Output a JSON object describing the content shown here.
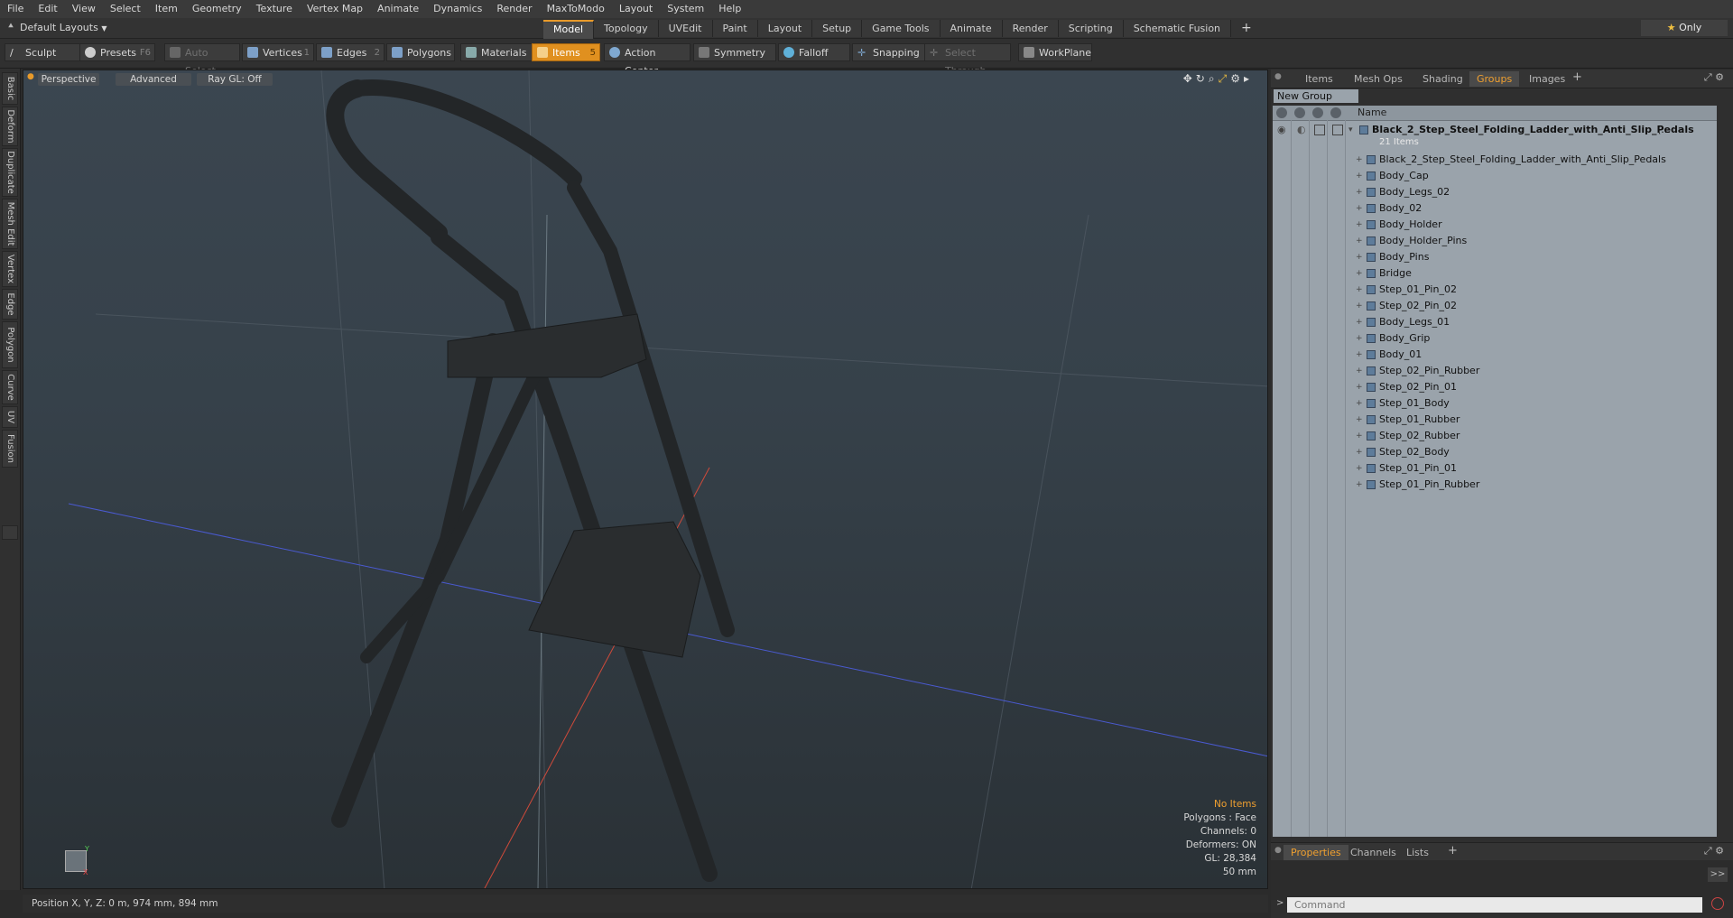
{
  "menu": [
    "File",
    "Edit",
    "View",
    "Select",
    "Item",
    "Geometry",
    "Texture",
    "Vertex Map",
    "Animate",
    "Dynamics",
    "Render",
    "MaxToModo",
    "Layout",
    "System",
    "Help"
  ],
  "layout_select": "Default Layouts",
  "layout_tabs": [
    "Model",
    "Topology",
    "UVEdit",
    "Paint",
    "Layout",
    "Setup",
    "Game Tools",
    "Animate",
    "Render",
    "Scripting",
    "Schematic Fusion"
  ],
  "layout_active": "Model",
  "add_tab": "+",
  "only_label": "Only",
  "toolbar": {
    "sculpt": "Sculpt",
    "presets": "Presets",
    "presets_key": "F6",
    "auto_select": "Auto Select",
    "vertices": "Vertices",
    "vertices_key": "1",
    "edges": "Edges",
    "edges_key": "2",
    "polygons": "Polygons",
    "materials": "Materials",
    "items": "Items",
    "items_key": "5",
    "action_center": "Action Center",
    "symmetry": "Symmetry",
    "falloff": "Falloff",
    "snapping": "Snapping",
    "select_through": "Select Through",
    "workplane": "WorkPlane"
  },
  "left_tabs": [
    "Basic",
    "Deform",
    "Duplicate",
    "Mesh Edit",
    "Vertex",
    "Edge",
    "Polygon",
    "Curve",
    "UV",
    "Fusion"
  ],
  "viewport": {
    "perspective": "Perspective",
    "advanced": "Advanced",
    "raygl": "Ray GL: Off",
    "info": {
      "no_items": "No Items",
      "polygons": "Polygons : Face",
      "channels": "Channels: 0",
      "deformers": "Deformers: ON",
      "gl": "GL: 28,384",
      "scale": "50 mm"
    }
  },
  "status": "Position X, Y, Z:  0 m, 974 mm, 894 mm",
  "right_panel": {
    "tabs": [
      "Items",
      "Mesh Ops",
      "Shading",
      "Groups",
      "Images"
    ],
    "active_tab": "Groups",
    "new_group": "New Group",
    "name_header": "Name",
    "group_name": "Black_2_Step_Steel_Folding_Ladder_with_Anti_Slip_Pedals",
    "group_suffix": "(...",
    "item_count": "21 Items",
    "items": [
      "Black_2_Step_Steel_Folding_Ladder_with_Anti_Slip_Pedals",
      "Body_Cap",
      "Body_Legs_02",
      "Body_02",
      "Body_Holder",
      "Body_Holder_Pins",
      "Body_Pins",
      "Bridge",
      "Step_01_Pin_02",
      "Step_02_Pin_02",
      "Body_Legs_01",
      "Body_Grip",
      "Body_01",
      "Step_02_Pin_Rubber",
      "Step_02_Pin_01",
      "Step_01_Body",
      "Step_01_Rubber",
      "Step_02_Rubber",
      "Step_02_Body",
      "Step_01_Pin_01",
      "Step_01_Pin_Rubber"
    ],
    "bottom_tabs": [
      "Properties",
      "Channels",
      "Lists"
    ],
    "bottom_active": "Properties",
    "command_placeholder": "Command",
    "expand_label": ">>"
  },
  "colors": {
    "accent": "#e89a2a",
    "tree_bg": "#9aa3ab"
  }
}
